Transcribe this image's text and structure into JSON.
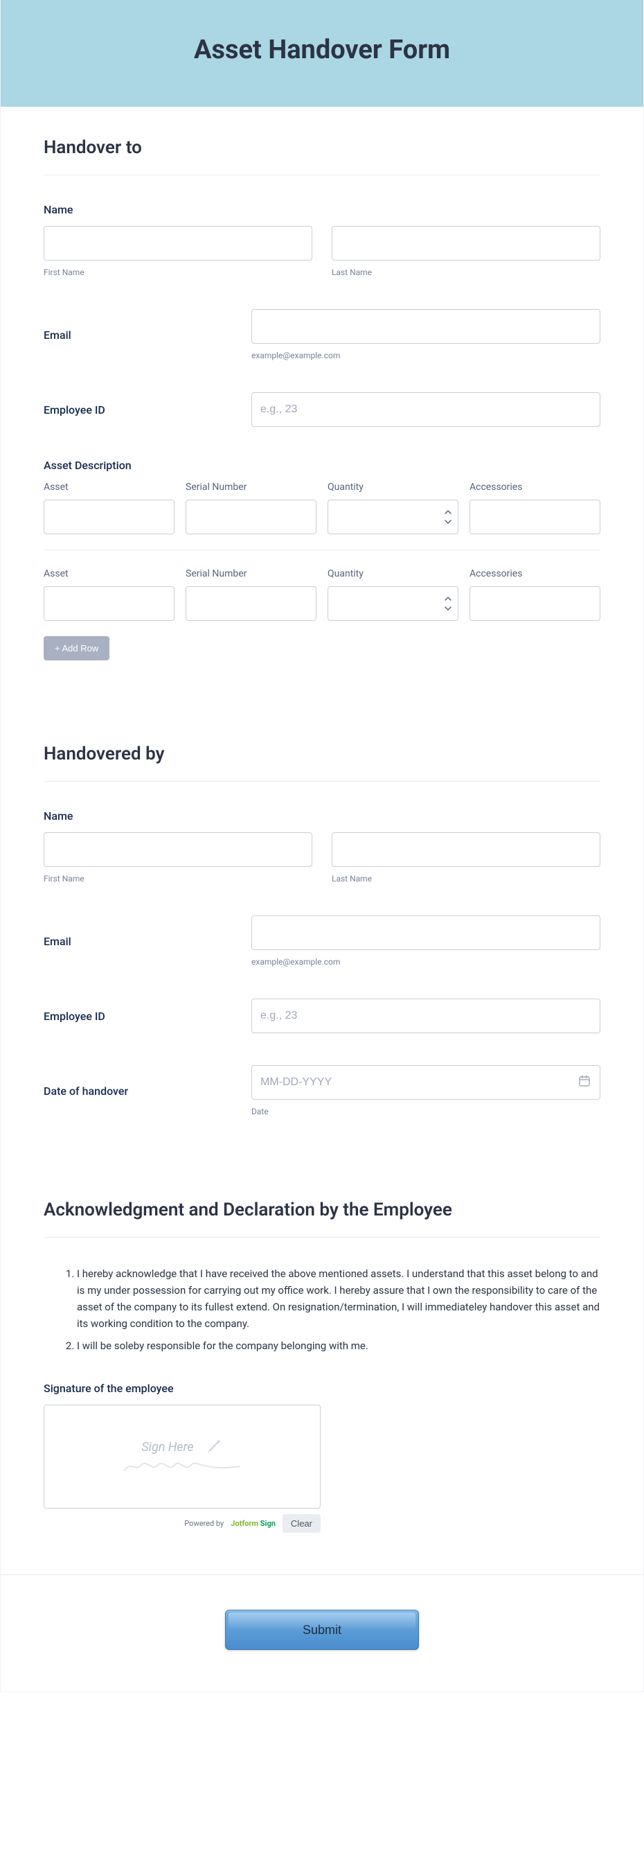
{
  "banner": {
    "title": "Asset Handover Form"
  },
  "section1": {
    "title": "Handover to",
    "name_label": "Name",
    "first_sub": "First Name",
    "last_sub": "Last Name",
    "email_label": "Email",
    "email_sub": "example@example.com",
    "empid_label": "Employee ID",
    "empid_placeholder": "e.g., 23",
    "asset_desc_label": "Asset Description",
    "headers": {
      "asset": "Asset",
      "serial": "Serial Number",
      "qty": "Quantity",
      "acc": "Accessories"
    },
    "add_row": "+ Add Row"
  },
  "section2": {
    "title": "Handovered by",
    "name_label": "Name",
    "first_sub": "First Name",
    "last_sub": "Last Name",
    "email_label": "Email",
    "email_sub": "example@example.com",
    "empid_label": "Employee ID",
    "empid_placeholder": "e.g., 23",
    "date_label": "Date of handover",
    "date_placeholder": "MM-DD-YYYY",
    "date_sub": "Date"
  },
  "section3": {
    "title": "Acknowledgment and Declaration by the Employee",
    "items": [
      "I hereby acknowledge that I have received the above mentioned assets. I understand that this asset belong to  and is my under possession for carrying out my office work. I hereby assure that I own the responsibility to care of the asset of the company to its fullest extend. On resignation/termination, I will immediateley handover this asset and its working condition to the company.",
      "I will be soleby responsible for the company belonging with me."
    ],
    "sig_label": "Signature of the employee",
    "sig_placeholder": "Sign Here",
    "powered": "Powered by",
    "brand1": "Jotform",
    "brand2": "Sign",
    "clear": "Clear"
  },
  "submit": {
    "label": "Submit"
  }
}
